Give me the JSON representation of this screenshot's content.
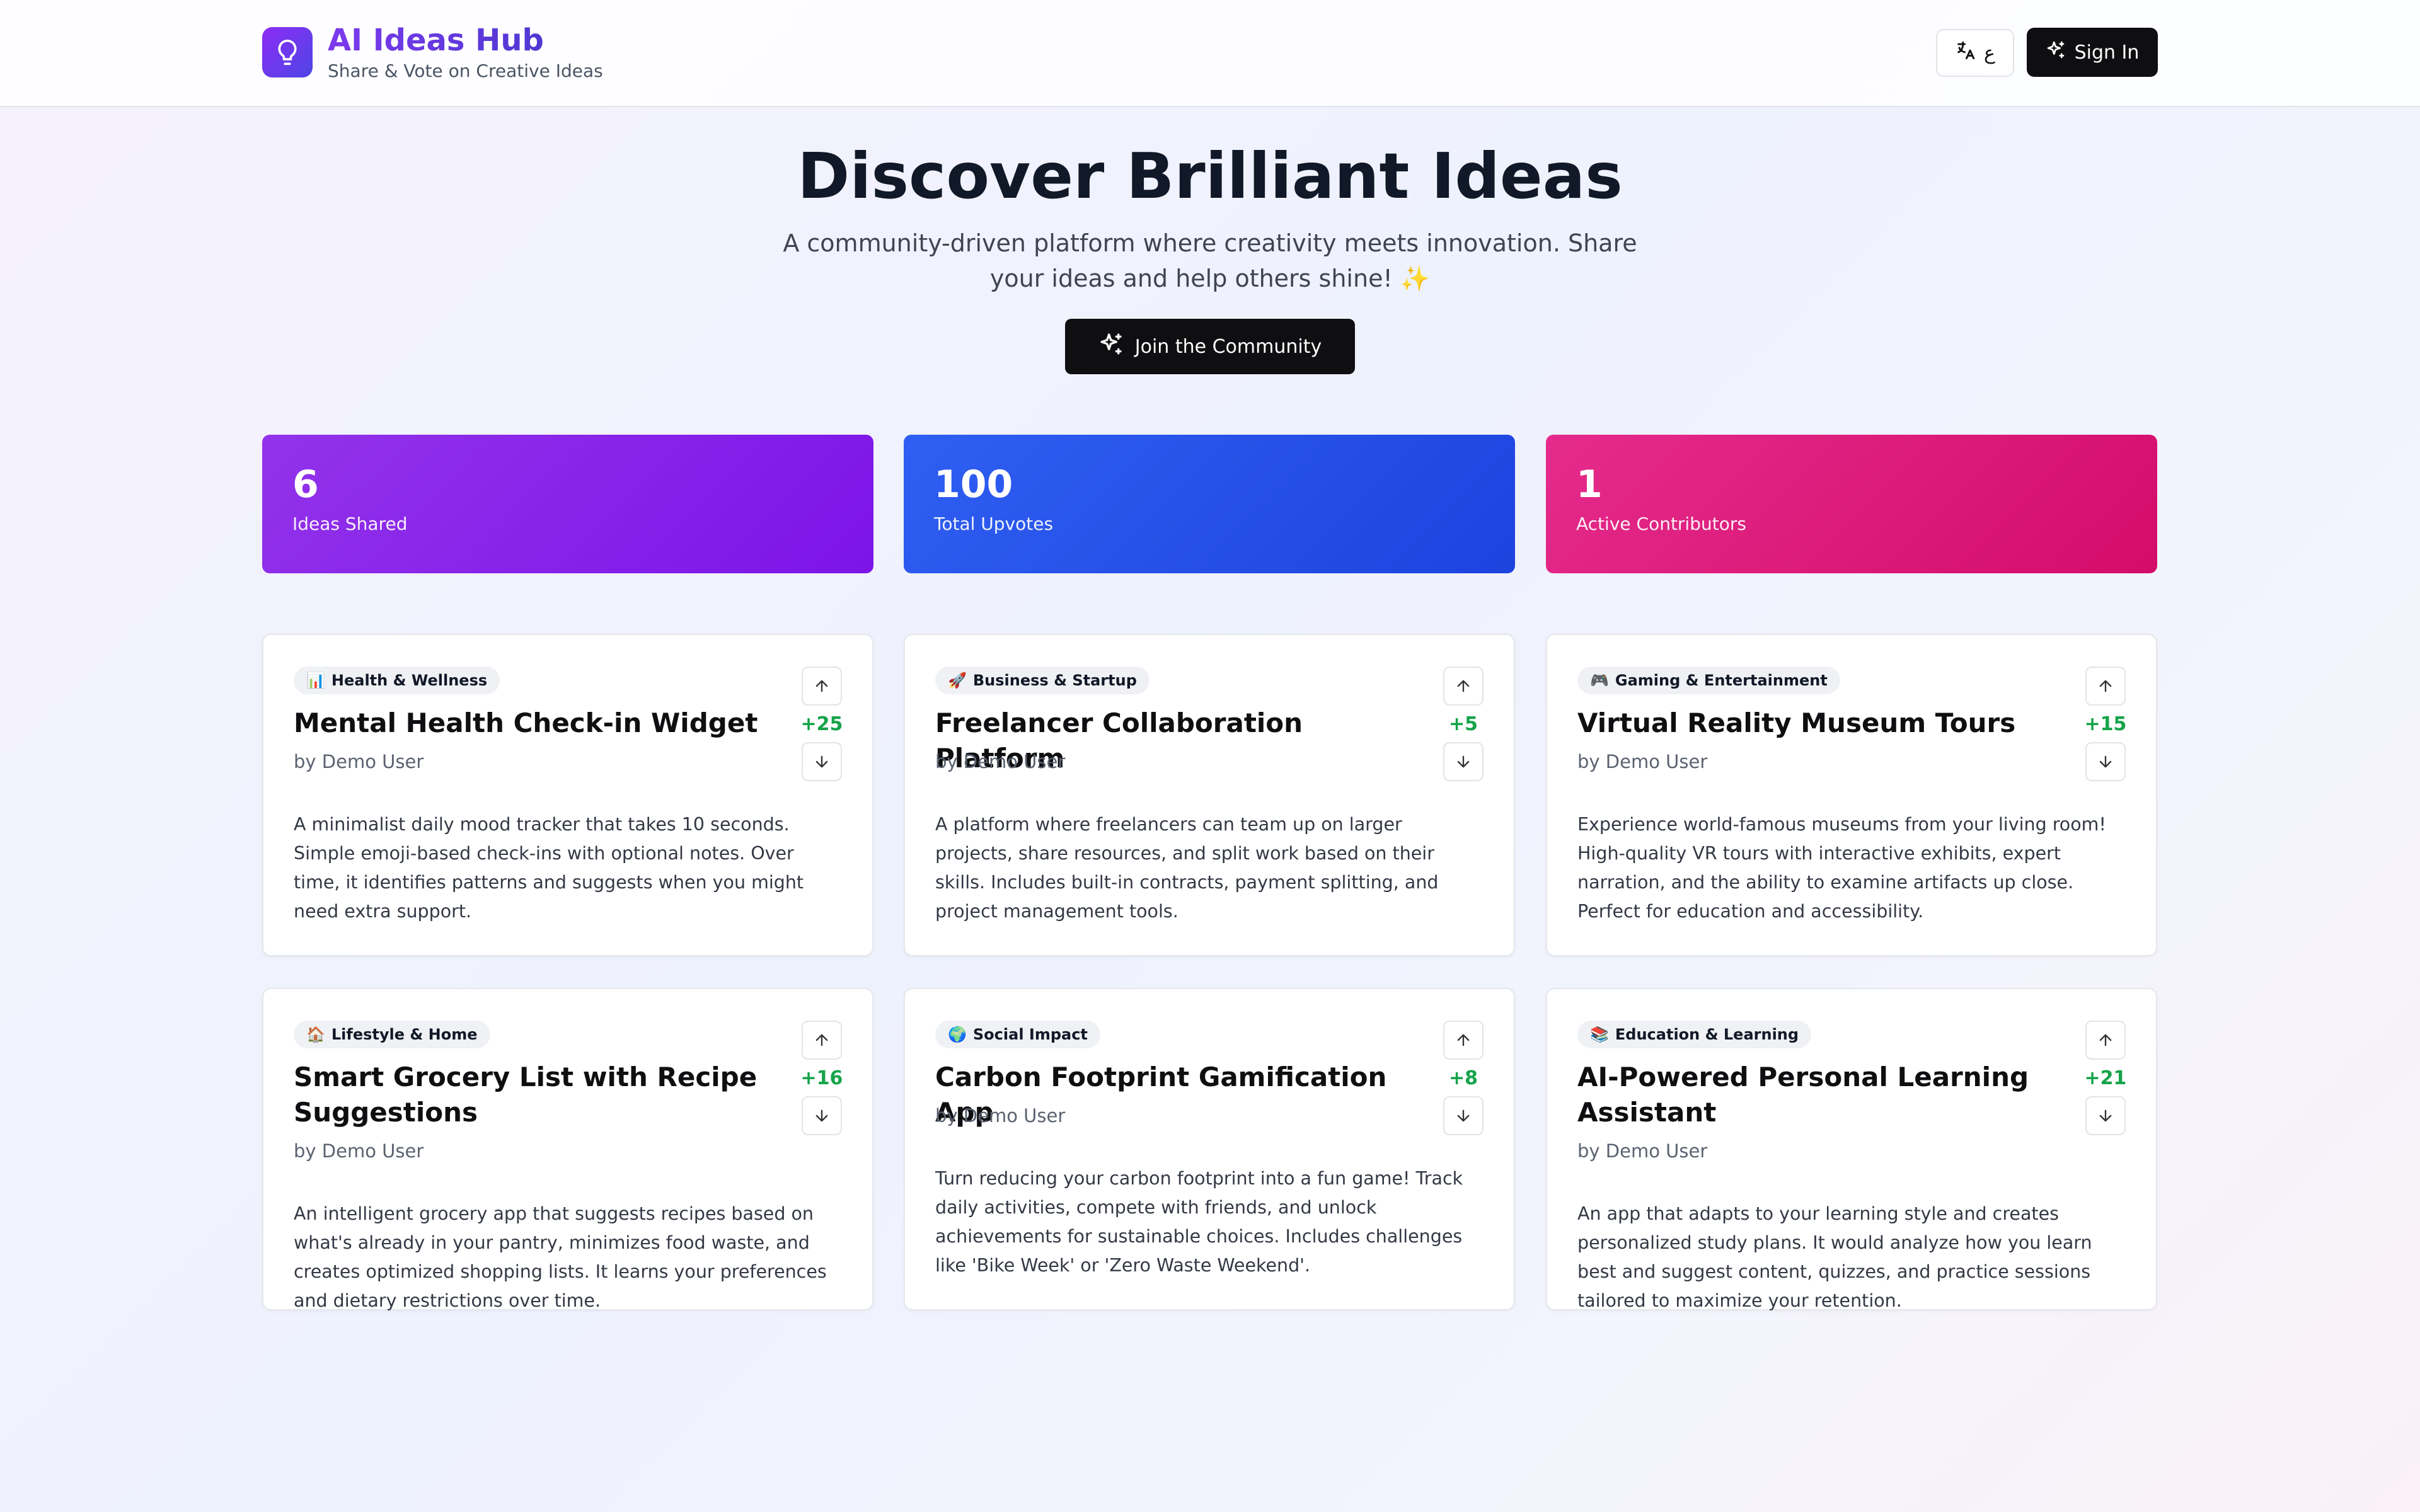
{
  "header": {
    "brand_title": "AI Ideas Hub",
    "brand_subtitle": "Share & Vote on Creative Ideas",
    "lang_label": "ع",
    "signin_label": "Sign In"
  },
  "hero": {
    "title": "Discover Brilliant Ideas",
    "subtitle": "A community-driven platform where creativity meets innovation. Share your ideas and help others shine! ✨",
    "cta_label": "Join the Community"
  },
  "stats": [
    {
      "value": "6",
      "label": "Ideas Shared"
    },
    {
      "value": "100",
      "label": "Total Upvotes"
    },
    {
      "value": "1",
      "label": "Active Contributors"
    }
  ],
  "ideas": [
    {
      "category_emoji": "📊",
      "category": "Health & Wellness",
      "title": "Mental Health Check-in Widget",
      "author": "by Demo User",
      "score": "+25",
      "description": "A minimalist daily mood tracker that takes 10 seconds. Simple emoji-based check-ins with optional notes. Over time, it identifies patterns and suggests when you might need extra support."
    },
    {
      "category_emoji": "🚀",
      "category": "Business & Startup",
      "title": "Freelancer Collaboration Platform",
      "author": "by Demo User",
      "score": "+5",
      "description": "A platform where freelancers can team up on larger projects, share resources, and split work based on their skills. Includes built-in contracts, payment splitting, and project management tools."
    },
    {
      "category_emoji": "🎮",
      "category": "Gaming & Entertainment",
      "title": "Virtual Reality Museum Tours",
      "author": "by Demo User",
      "score": "+15",
      "description": "Experience world-famous museums from your living room! High-quality VR tours with interactive exhibits, expert narration, and the ability to examine artifacts up close. Perfect for education and accessibility."
    },
    {
      "category_emoji": "🏠",
      "category": "Lifestyle & Home",
      "title": "Smart Grocery List with Recipe Suggestions",
      "author": "by Demo User",
      "score": "+16",
      "description": "An intelligent grocery app that suggests recipes based on what's already in your pantry, minimizes food waste, and creates optimized shopping lists. It learns your preferences and dietary restrictions over time."
    },
    {
      "category_emoji": "🌍",
      "category": "Social Impact",
      "title": "Carbon Footprint Gamification App",
      "author": "by Demo User",
      "score": "+8",
      "description": "Turn reducing your carbon footprint into a fun game! Track daily activities, compete with friends, and unlock achievements for sustainable choices. Includes challenges like 'Bike Week' or 'Zero Waste Weekend'."
    },
    {
      "category_emoji": "📚",
      "category": "Education & Learning",
      "title": "AI-Powered Personal Learning Assistant",
      "author": "by Demo User",
      "score": "+21",
      "description": "An app that adapts to your learning style and creates personalized study plans. It would analyze how you learn best and suggest content, quizzes, and practice sessions tailored to maximize your retention."
    }
  ]
}
